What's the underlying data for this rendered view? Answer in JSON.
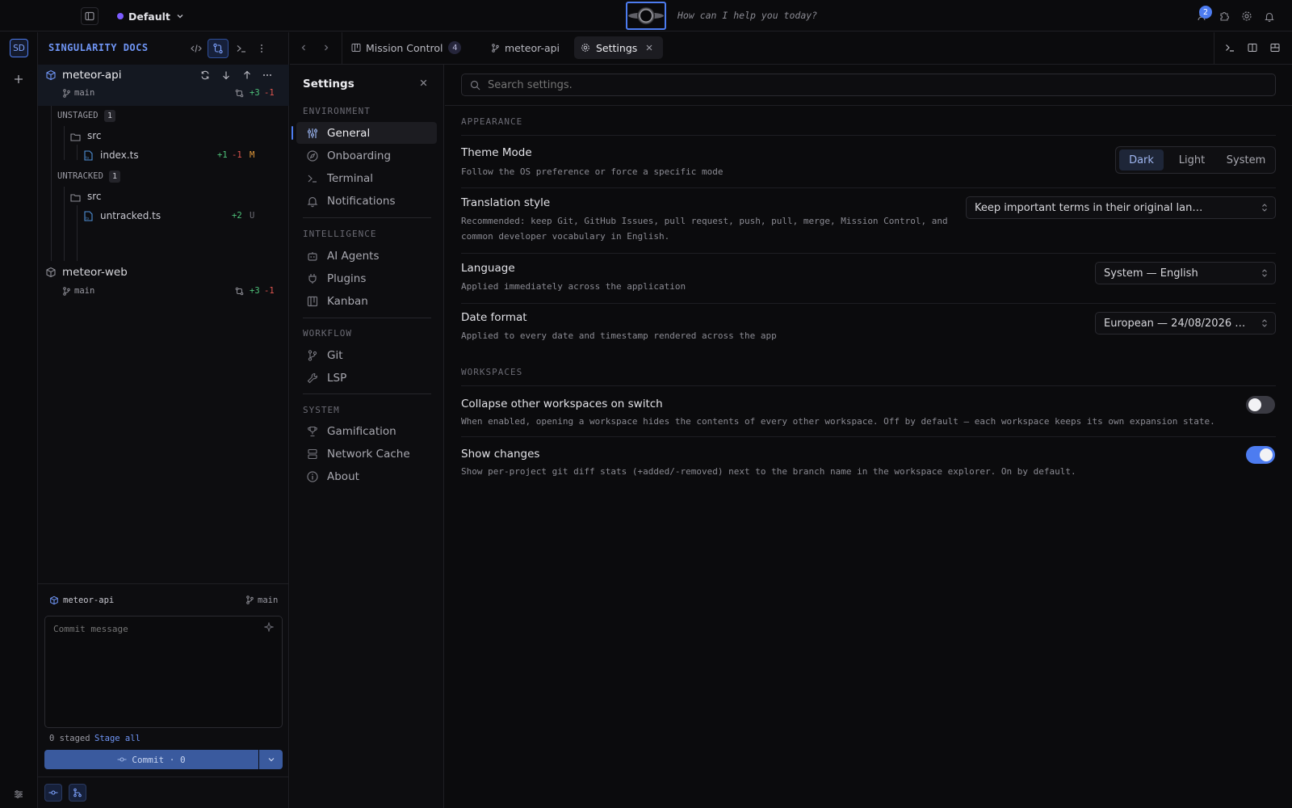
{
  "topbar": {
    "workspace_name": "Default",
    "workspace_dot_color": "#7c5cff",
    "prompt_placeholder": "How can I help you today?",
    "notification_count": "2"
  },
  "rail": {
    "avatar_initials": "SD"
  },
  "sidebar": {
    "title": "SINGULARITY DOCS",
    "projects": [
      {
        "name": "meteor-api",
        "branch": "main",
        "added": "+3",
        "removed": "-1"
      },
      {
        "name": "meteor-web",
        "branch": "main",
        "added": "+3",
        "removed": "-1"
      }
    ],
    "unstaged": {
      "label": "UNSTAGED",
      "count": "1",
      "folder": "src",
      "file": "index.ts",
      "added": "+1",
      "removed": "-1",
      "status": "M"
    },
    "untracked": {
      "label": "UNTRACKED",
      "count": "1",
      "folder": "src",
      "file": "untracked.ts",
      "added": "+2",
      "status": "U"
    },
    "commit": {
      "project": "meteor-api",
      "branch": "main",
      "message_placeholder": "Commit message",
      "staged_text": "0 staged",
      "stage_all": "Stage all",
      "button_label": "Commit · 0"
    }
  },
  "tabs": [
    {
      "label": "Mission Control",
      "badge": "4"
    },
    {
      "label": "meteor-api"
    },
    {
      "label": "Settings"
    }
  ],
  "settings_nav": {
    "title": "Settings",
    "sections": [
      {
        "label": "ENVIRONMENT",
        "items": [
          "General",
          "Onboarding",
          "Terminal",
          "Notifications"
        ]
      },
      {
        "label": "INTELLIGENCE",
        "items": [
          "AI Agents",
          "Plugins",
          "Kanban"
        ]
      },
      {
        "label": "WORKFLOW",
        "items": [
          "Git",
          "LSP"
        ]
      },
      {
        "label": "SYSTEM",
        "items": [
          "Gamification",
          "Network Cache",
          "About"
        ]
      }
    ],
    "active_item": "General"
  },
  "settings": {
    "search_placeholder": "Search settings.",
    "appearance_header": "APPEARANCE",
    "theme": {
      "title": "Theme Mode",
      "desc": "Follow the OS preference or force a specific mode",
      "options": [
        "Dark",
        "Light",
        "System"
      ],
      "selected": "Dark"
    },
    "translation": {
      "title": "Translation style",
      "desc_line1": "Recommended: keep Git, GitHub Issues, pull request, push, pull, merge, Mission Control, and",
      "desc_line2": "common developer vocabulary in English.",
      "value": "Keep important terms in their original lan…"
    },
    "language": {
      "title": "Language",
      "desc": "Applied immediately across the application",
      "value": "System — English"
    },
    "date_format": {
      "title": "Date format",
      "desc": "Applied to every date and timestamp rendered across the app",
      "value": "European — 24/08/2026 …"
    },
    "workspaces_header": "WORKSPACES",
    "collapse": {
      "title": "Collapse other workspaces on switch",
      "desc": "When enabled, opening a workspace hides the contents of every other workspace. Off by default — each workspace keeps its own expansion state.",
      "enabled": false
    },
    "show_changes": {
      "title": "Show changes",
      "desc": "Show per-project git diff stats (+added/-removed) next to the branch name in the workspace explorer. On by default.",
      "enabled": true
    }
  },
  "colors": {
    "accent": "#4d7cf0",
    "commit_button": "#3a5a9e",
    "toggle_on": "#4d7cf0",
    "toggle_off": "#3a3a42"
  }
}
